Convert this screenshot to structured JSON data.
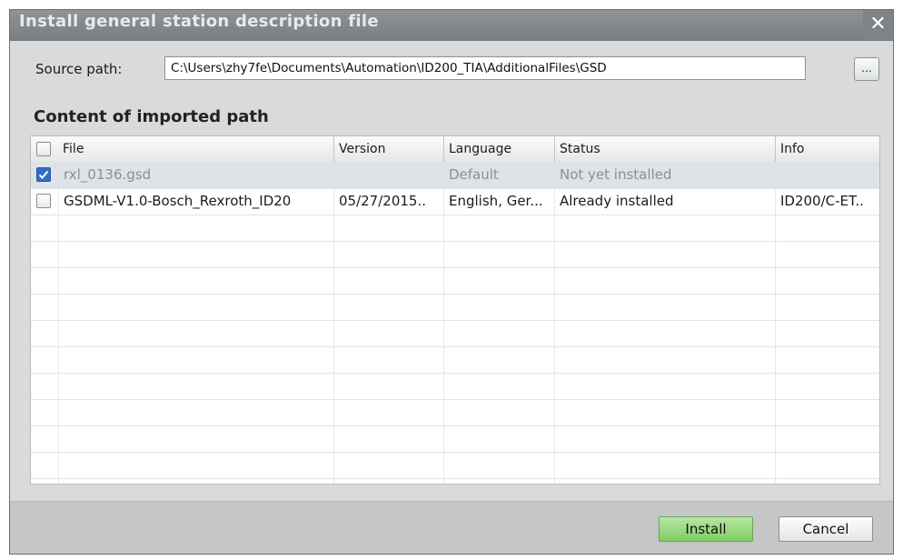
{
  "dialog": {
    "title": "Install general station description file",
    "close_symbol": "✕"
  },
  "source": {
    "label": "Source path:",
    "value": "C:\\Users\\zhy7fe\\Documents\\Automation\\ID200_TIA\\AdditionalFiles\\GSD",
    "browse_label": "..."
  },
  "content": {
    "title": "Content of imported path",
    "columns": [
      "File",
      "Version",
      "Language",
      "Status",
      "Info"
    ],
    "rows": [
      {
        "checked": true,
        "file": "rxl_0136.gsd",
        "version": "",
        "language": "Default",
        "status": "Not yet installed",
        "info": ""
      },
      {
        "checked": false,
        "file": "GSDML-V1.0-Bosch_Rexroth_ID20",
        "version": "05/27/2015..",
        "language": "English, Ger...",
        "status": "Already installed",
        "info": "ID200/C-ET.."
      }
    ]
  },
  "footer": {
    "install_label": "Install",
    "cancel_label": "Cancel"
  },
  "colors": {
    "install_button": "#8fd674",
    "checkbox_checked": "#2f6fc6"
  }
}
